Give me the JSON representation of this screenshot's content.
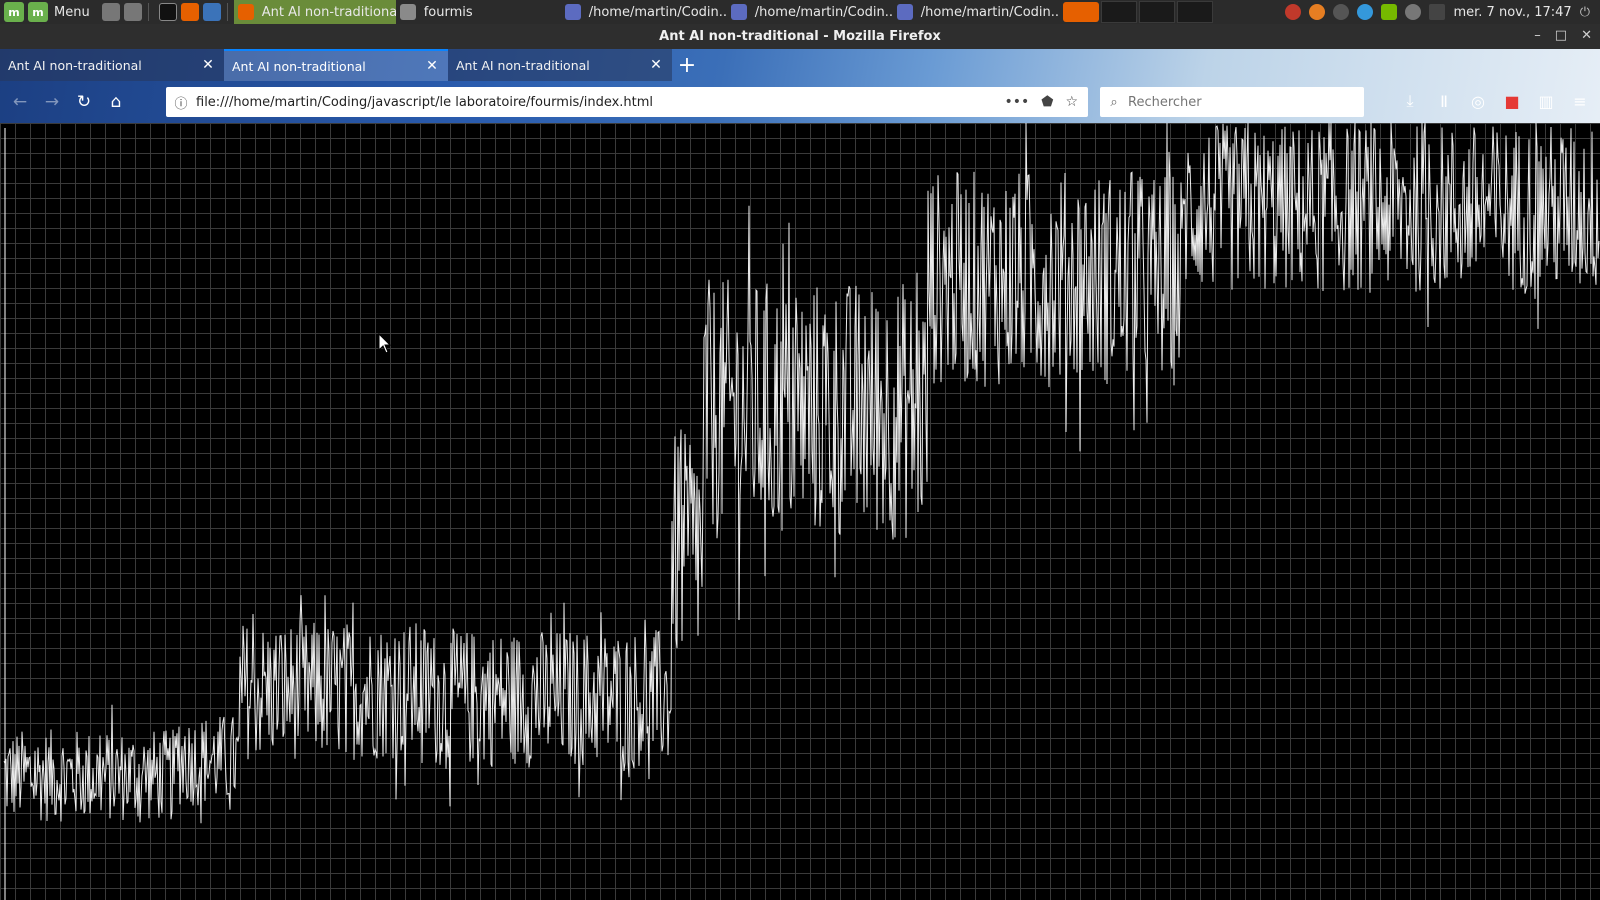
{
  "taskbar": {
    "menu_label": "Menu",
    "windows": [
      {
        "label": "Ant AI non-traditiona...",
        "active": true
      },
      {
        "label": "fourmis",
        "active": false
      },
      {
        "label": "/home/martin/Codin...",
        "active": false
      },
      {
        "label": "/home/martin/Codin...",
        "active": false
      },
      {
        "label": "/home/martin/Codin...",
        "active": false
      }
    ],
    "clock": "mer. 7 nov., 17:47"
  },
  "window": {
    "title": "Ant AI non-traditional - Mozilla Firefox"
  },
  "tabs": [
    {
      "label": "Ant AI non-traditional",
      "selected": false
    },
    {
      "label": "Ant AI non-traditional",
      "selected": true
    },
    {
      "label": "Ant AI non-traditional",
      "selected": false
    }
  ],
  "navbar": {
    "url": "file:///home/martin/Coding/javascript/le laboratoire/fourmis/index.html",
    "search_placeholder": "Rechercher"
  },
  "icons": {
    "back": "back-arrow-icon",
    "forward": "forward-arrow-icon",
    "reload": "reload-icon",
    "home": "home-icon",
    "info": "info-icon",
    "more": "more-dots-icon",
    "pocket": "pocket-icon",
    "bookmark": "star-icon",
    "search": "search-icon",
    "downloads": "download-icon",
    "library": "library-icon",
    "sidebar": "sidebar-icon",
    "menu": "hamburger-menu-icon"
  },
  "colors": {
    "page_background": "#000000",
    "grid": "#3a3a3a",
    "signal": "#ffffff",
    "tab_accent": "#0a84ff"
  },
  "chart_data": {
    "type": "line",
    "title": "",
    "xlabel": "",
    "ylabel": "",
    "grid": true,
    "xlim": [
      0,
      1
    ],
    "ylim": [
      0,
      1
    ],
    "style": "dense white vertical noise trace on black grid",
    "segments": [
      {
        "x_range": [
          0.0,
          0.11
        ],
        "center": 0.16,
        "spread": 0.06
      },
      {
        "x_range": [
          0.11,
          0.15
        ],
        "center": 0.18,
        "spread": 0.06
      },
      {
        "x_range": [
          0.15,
          0.27
        ],
        "center": 0.27,
        "spread": 0.09
      },
      {
        "x_range": [
          0.27,
          0.42
        ],
        "center": 0.26,
        "spread": 0.09
      },
      {
        "x_range": [
          0.42,
          0.44
        ],
        "center": 0.45,
        "spread": 0.15
      },
      {
        "x_range": [
          0.44,
          0.58
        ],
        "center": 0.63,
        "spread": 0.17
      },
      {
        "x_range": [
          0.58,
          0.74
        ],
        "center": 0.8,
        "spread": 0.14
      },
      {
        "x_range": [
          0.74,
          1.0
        ],
        "center": 0.89,
        "spread": 0.11
      }
    ]
  }
}
